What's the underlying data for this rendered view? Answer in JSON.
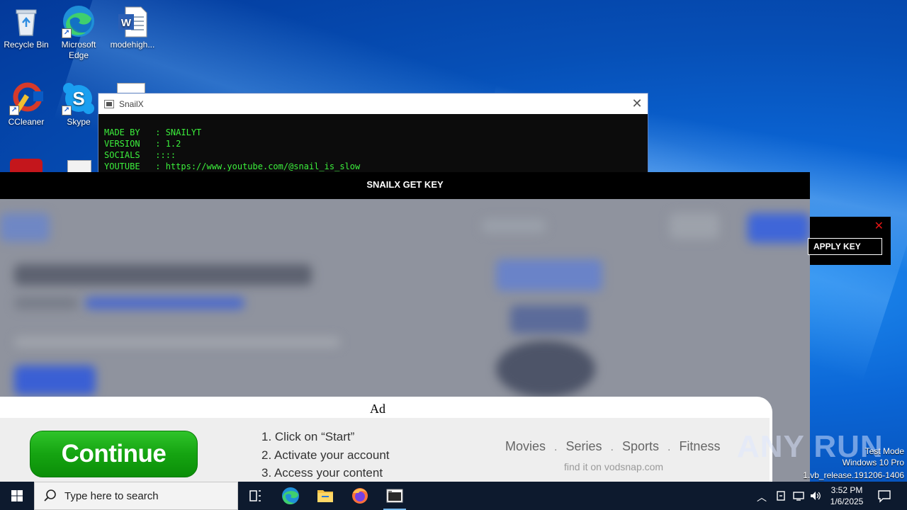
{
  "desktop": {
    "icons": [
      {
        "label": "Recycle Bin",
        "icon": "recycle-bin-icon"
      },
      {
        "label": "Microsoft Edge",
        "icon": "edge-icon"
      },
      {
        "label": "modehigh...",
        "icon": "word-document-icon"
      },
      {
        "label": "CCleaner",
        "icon": "ccleaner-icon"
      },
      {
        "label": "Skype",
        "icon": "skype-icon"
      }
    ]
  },
  "console": {
    "title": "SnailX",
    "lines": [
      "MADE BY   : SNAILYT",
      "VERSION   : 1.2",
      "SOCIALS   ::::",
      "YOUTUBE   : https://www.youtube.com/@snail_is_slow"
    ]
  },
  "getkey": {
    "title": "SNAILX GET KEY"
  },
  "applykey": {
    "button_label": "APPLY KEY",
    "close_glyph": "✕"
  },
  "ad": {
    "label": "Ad",
    "continue_label": "Continue",
    "steps": [
      "1. Click on “Start”",
      "2. Activate your account",
      "3. Access your content"
    ],
    "categories": [
      "Movies",
      "Series",
      "Sports",
      "Fitness"
    ],
    "findit": "find it on vodsnap.com"
  },
  "watermark": {
    "logo": "ANY RUN",
    "line1": "Test Mode",
    "line2": "Windows 10 Pro",
    "line3": "1.vb_release.191206-1406"
  },
  "taskbar": {
    "search_placeholder": "Type here to search",
    "time": "3:52 PM",
    "date": "1/6/2025"
  },
  "colors": {
    "console_text": "#3cf03c",
    "taskbar": "#0d1a2e",
    "ad_button": "#15a411",
    "close_red": "#e01515"
  }
}
